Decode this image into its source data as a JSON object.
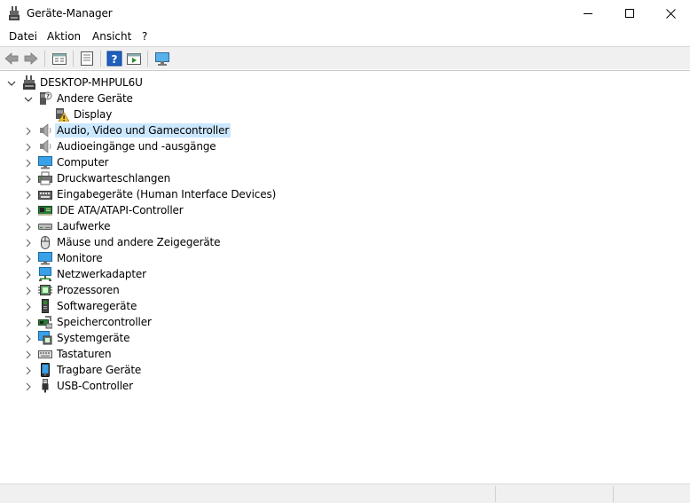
{
  "window": {
    "title": "Geräte-Manager"
  },
  "menu": [
    "Datei",
    "Aktion",
    "Ansicht",
    "?"
  ],
  "toolbar": {
    "buttons": [
      "back-icon",
      "forward-icon",
      "properties-icon",
      "refresh-icon",
      "help-icon",
      "run-icon",
      "monitor-icon"
    ]
  },
  "tree": {
    "root": "DESKTOP-MHPUL6U",
    "items": [
      {
        "label": "Andere Geräte",
        "icon": "unknown-device-icon",
        "expanded": true
      },
      {
        "label": "Display",
        "icon": "warning-device-icon"
      },
      {
        "label": "Audio, Video und Gamecontroller",
        "icon": "speaker-icon",
        "selected": true
      },
      {
        "label": "Audioeingänge und -ausgänge",
        "icon": "speaker-icon"
      },
      {
        "label": "Computer",
        "icon": "computer-icon"
      },
      {
        "label": "Druckwarteschlangen",
        "icon": "printer-icon"
      },
      {
        "label": "Eingabegeräte (Human Interface Devices)",
        "icon": "keyboard-hid-icon"
      },
      {
        "label": "IDE ATA/ATAPI-Controller",
        "icon": "ide-controller-icon"
      },
      {
        "label": "Laufwerke",
        "icon": "drive-icon"
      },
      {
        "label": "Mäuse und andere Zeigegeräte",
        "icon": "mouse-icon"
      },
      {
        "label": "Monitore",
        "icon": "monitor-icon"
      },
      {
        "label": "Netzwerkadapter",
        "icon": "network-icon"
      },
      {
        "label": "Prozessoren",
        "icon": "processor-icon"
      },
      {
        "label": "Softwaregeräte",
        "icon": "software-device-icon"
      },
      {
        "label": "Speichercontroller",
        "icon": "storage-controller-icon"
      },
      {
        "label": "Systemgeräte",
        "icon": "system-device-icon"
      },
      {
        "label": "Tastaturen",
        "icon": "keyboard-icon"
      },
      {
        "label": "Tragbare Geräte",
        "icon": "portable-device-icon"
      },
      {
        "label": "USB-Controller",
        "icon": "usb-icon"
      }
    ]
  },
  "colors": {
    "selection": "#cce8ff",
    "toolbar_bg": "#f0f0f0",
    "help_blue": "#1f5fbf"
  }
}
